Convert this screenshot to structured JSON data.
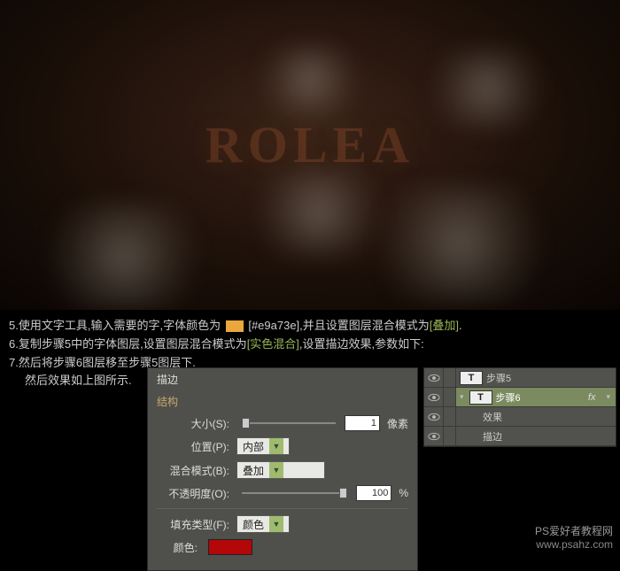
{
  "canvas": {
    "title_text": "ROLEA"
  },
  "instructions": {
    "line5_a": "5.使用文字工具,输入需要的字,字体颜色为",
    "line5_b": "[#e9a73e],并且设置图层混合模式为",
    "line5_c": "[叠加]",
    "line5_d": ".",
    "line6_a": "6.复制步骤5中的字体图层,设置图层混合模式为",
    "line6_b": "[实色混合]",
    "line6_c": ",设置描边效果,参数如下:",
    "line7_a": "7.然后将步骤6图层移至步骤5图层下.",
    "line7_b": "然后效果如上图所示."
  },
  "stroke_panel": {
    "title": "描边",
    "group": "结构",
    "size_label": "大小(S):",
    "size_value": "1",
    "size_unit": "像素",
    "position_label": "位置(P):",
    "position_value": "内部",
    "blend_label": "混合模式(B):",
    "blend_value": "叠加",
    "opacity_label": "不透明度(O):",
    "opacity_value": "100",
    "opacity_unit": "%",
    "fill_type_label": "填充类型(F):",
    "fill_type_value": "颜色",
    "color_label": "颜色:",
    "color_hex": "#b3070a"
  },
  "layers": {
    "row1": {
      "thumb": "T",
      "name": "步骤5"
    },
    "row2": {
      "thumb": "T",
      "name": "步骤6",
      "fx": "fx"
    },
    "row3": {
      "name": "效果"
    },
    "row4": {
      "name": "描边"
    }
  },
  "watermark": {
    "cn": "PS爱好者教程网",
    "url": "www.psahz.com"
  }
}
